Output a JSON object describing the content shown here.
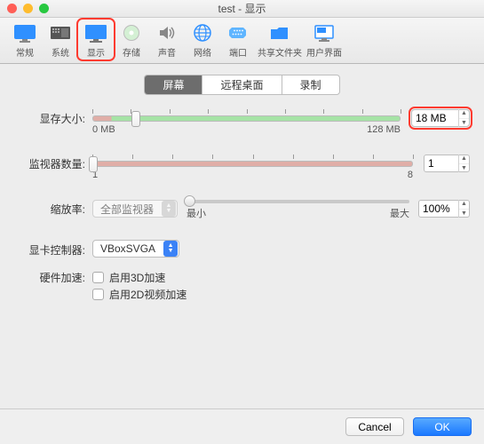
{
  "window": {
    "title": "test - 显示",
    "selected_tool_index": 2
  },
  "toolbar": [
    {
      "label": "常规",
      "id": "general"
    },
    {
      "label": "系统",
      "id": "system"
    },
    {
      "label": "显示",
      "id": "display"
    },
    {
      "label": "存储",
      "id": "storage"
    },
    {
      "label": "声音",
      "id": "audio"
    },
    {
      "label": "网络",
      "id": "network"
    },
    {
      "label": "端口",
      "id": "ports"
    },
    {
      "label": "共享文件夹",
      "id": "shared-folders"
    },
    {
      "label": "用户界面",
      "id": "user-interface"
    }
  ],
  "tabs": {
    "items": [
      "屏幕",
      "远程桌面",
      "录制"
    ],
    "active_index": 0
  },
  "labels": {
    "video_memory": "显存大小:",
    "monitor_count": "监视器数量:",
    "scale_factor": "缩放率:",
    "gfx_controller": "显卡控制器:",
    "hw_accel": "硬件加速:",
    "min": "最小",
    "max": "最大",
    "all_monitors": "全部监视器"
  },
  "video_memory": {
    "value": "18 MB",
    "slider_pct": 14,
    "min_label": "0 MB",
    "max_label": "128 MB"
  },
  "monitor_count": {
    "value": "1",
    "slider_pct": 0,
    "min_label": "1",
    "max_label": "8"
  },
  "scale_factor": {
    "value": "100%",
    "slider_pct": 0
  },
  "gfx_controller": {
    "value": "VBoxSVGA"
  },
  "hw_accel": {
    "enable_3d": "启用3D加速",
    "enable_3d_checked": false,
    "enable_2d": "启用2D视频加速",
    "enable_2d_checked": false
  },
  "buttons": {
    "cancel": "Cancel",
    "ok": "OK"
  },
  "highlight_color": "#ff3b30"
}
